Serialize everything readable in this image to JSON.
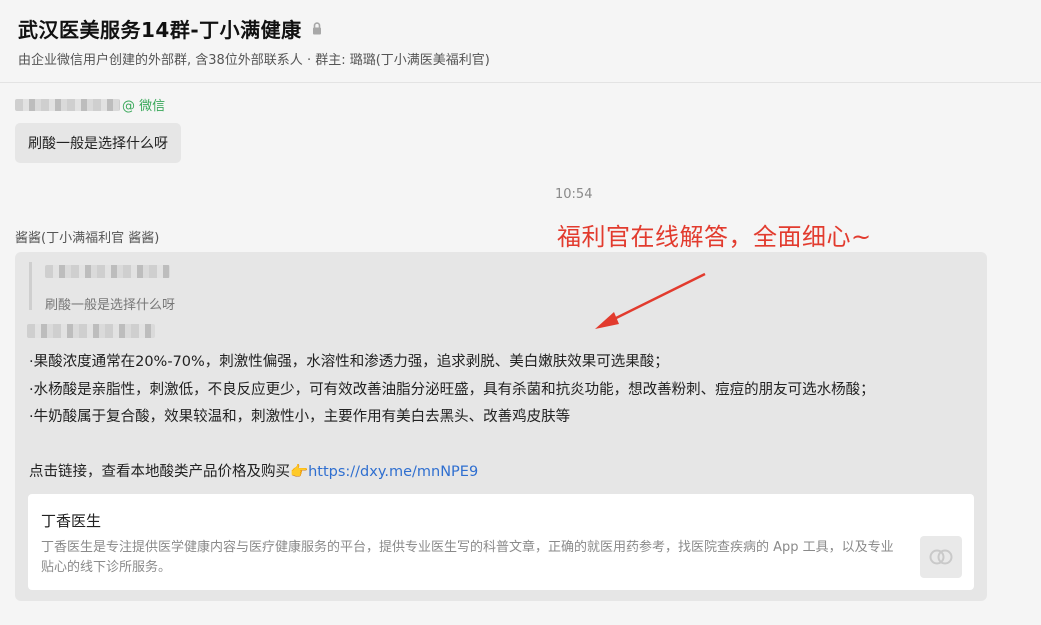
{
  "header": {
    "title": "武汉医美服务14群-丁小满健康",
    "subtitle": "由企业微信用户创建的外部群, 含38位外部联系人 · 群主: 璐璐(丁小满医美福利官)"
  },
  "message1": {
    "sender_suffix": "@ 微信",
    "text": "刷酸一般是选择什么呀"
  },
  "timestamp": "10:54",
  "message2": {
    "sender": "酱酱(丁小满福利官 酱酱)",
    "quote_text": "刷酸一般是选择什么呀",
    "lines": [
      "·果酸浓度通常在20%-70%，刺激性偏强，水溶性和渗透力强，追求剥脱、美白嫩肤效果可选果酸；",
      "·水杨酸是亲脂性，刺激低，不良反应更少，可有效改善油脂分泌旺盛，具有杀菌和抗炎功能，想改善粉刺、痘痘的朋友可选水杨酸；",
      "·牛奶酸属于复合酸，效果较温和，刺激性小，主要作用有美白去黑头、改善鸡皮肤等"
    ],
    "link_prefix": "点击链接，查看本地酸类产品价格及购买👉",
    "link_url": "https://dxy.me/mnNPE9",
    "card": {
      "title": "丁香医生",
      "description": "丁香医生是专注提供医学健康内容与医疗健康服务的平台，提供专业医生写的科普文章，正确的就医用药参考，找医院查疾病的 App 工具，以及专业贴心的线下诊所服务。",
      "icon": "link-icon"
    }
  },
  "annotation": {
    "text": "福利官在线解答，全面细心~",
    "color": "#e23b2e"
  }
}
